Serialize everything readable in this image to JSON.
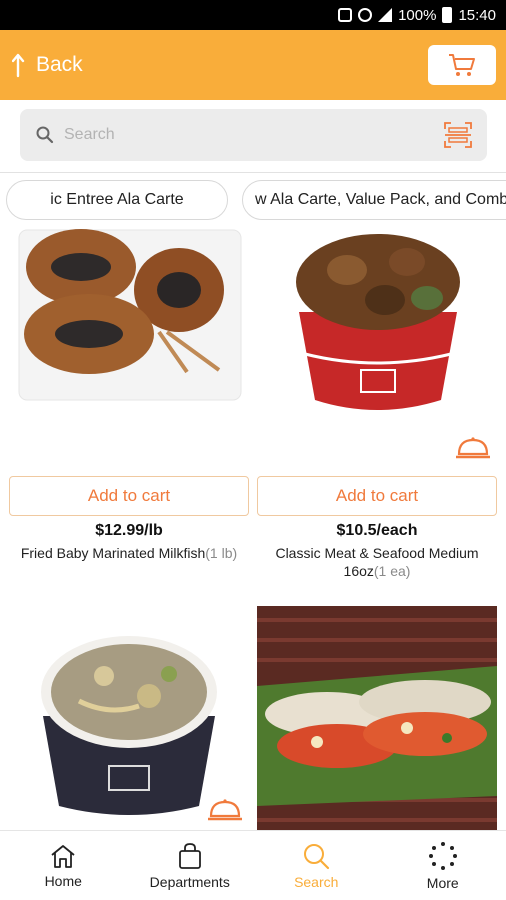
{
  "status_bar": {
    "battery": "100%",
    "time": "15:40"
  },
  "header": {
    "back_label": "Back"
  },
  "search": {
    "placeholder": "Search"
  },
  "categories": [
    {
      "label": "ic Entree Ala Carte"
    },
    {
      "label": "w Ala Carte, Value Pack, and Combos"
    }
  ],
  "products": [
    {
      "add_label": "Add to cart",
      "price": "$12.99/lb",
      "name": "Fried Baby Marinated Milkfish",
      "qty": "(1 lb)"
    },
    {
      "add_label": "Add to cart",
      "price": "$10.5/each",
      "name": "Classic Meat & Seafood Medium 16oz",
      "qty": "(1 ea)"
    },
    {
      "add_label": "",
      "price": "",
      "name": "",
      "qty": ""
    },
    {
      "add_label": "",
      "price": "",
      "name": "",
      "qty": ""
    }
  ],
  "bottom_nav": [
    {
      "label": "Home",
      "icon": "home-icon"
    },
    {
      "label": "Departments",
      "icon": "bag-icon"
    },
    {
      "label": "Search",
      "icon": "search-icon"
    },
    {
      "label": "More",
      "icon": "more-icon"
    }
  ],
  "colors": {
    "brand": "#f9ad3a",
    "accent": "#f07a3c"
  }
}
